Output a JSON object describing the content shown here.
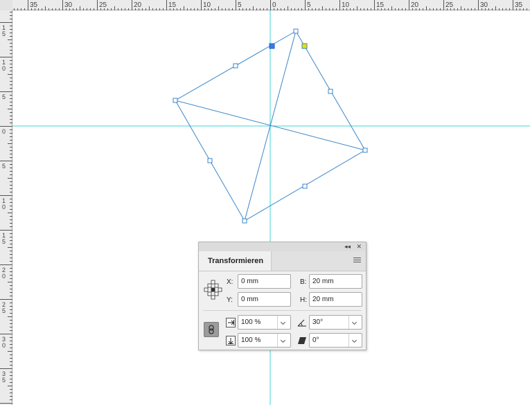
{
  "ruler": {
    "top_labels": [
      "35",
      "30",
      "25",
      "20",
      "15",
      "10",
      "5",
      "0",
      "5",
      "10",
      "15",
      "20",
      "25",
      "30",
      "35"
    ],
    "left_labels": [
      "15",
      "10",
      "5",
      "0",
      "5",
      "10",
      "15",
      "20",
      "25",
      "30",
      "35"
    ]
  },
  "guide_color": "#3fd5d5",
  "path_color": "#3a86c8",
  "panel": {
    "title_controls": {
      "collapse": "◂◂",
      "close": "✕"
    },
    "tab_label": "Transformieren",
    "x_label": "X:",
    "x_value": "0 mm",
    "y_label": "Y:",
    "y_value": "0 mm",
    "w_label": "B:",
    "w_value": "20 mm",
    "h_label": "H:",
    "h_value": "20 mm",
    "scale_x_value": "100 %",
    "scale_y_value": "100 %",
    "rotate_value": "30°",
    "shear_value": "0°"
  }
}
